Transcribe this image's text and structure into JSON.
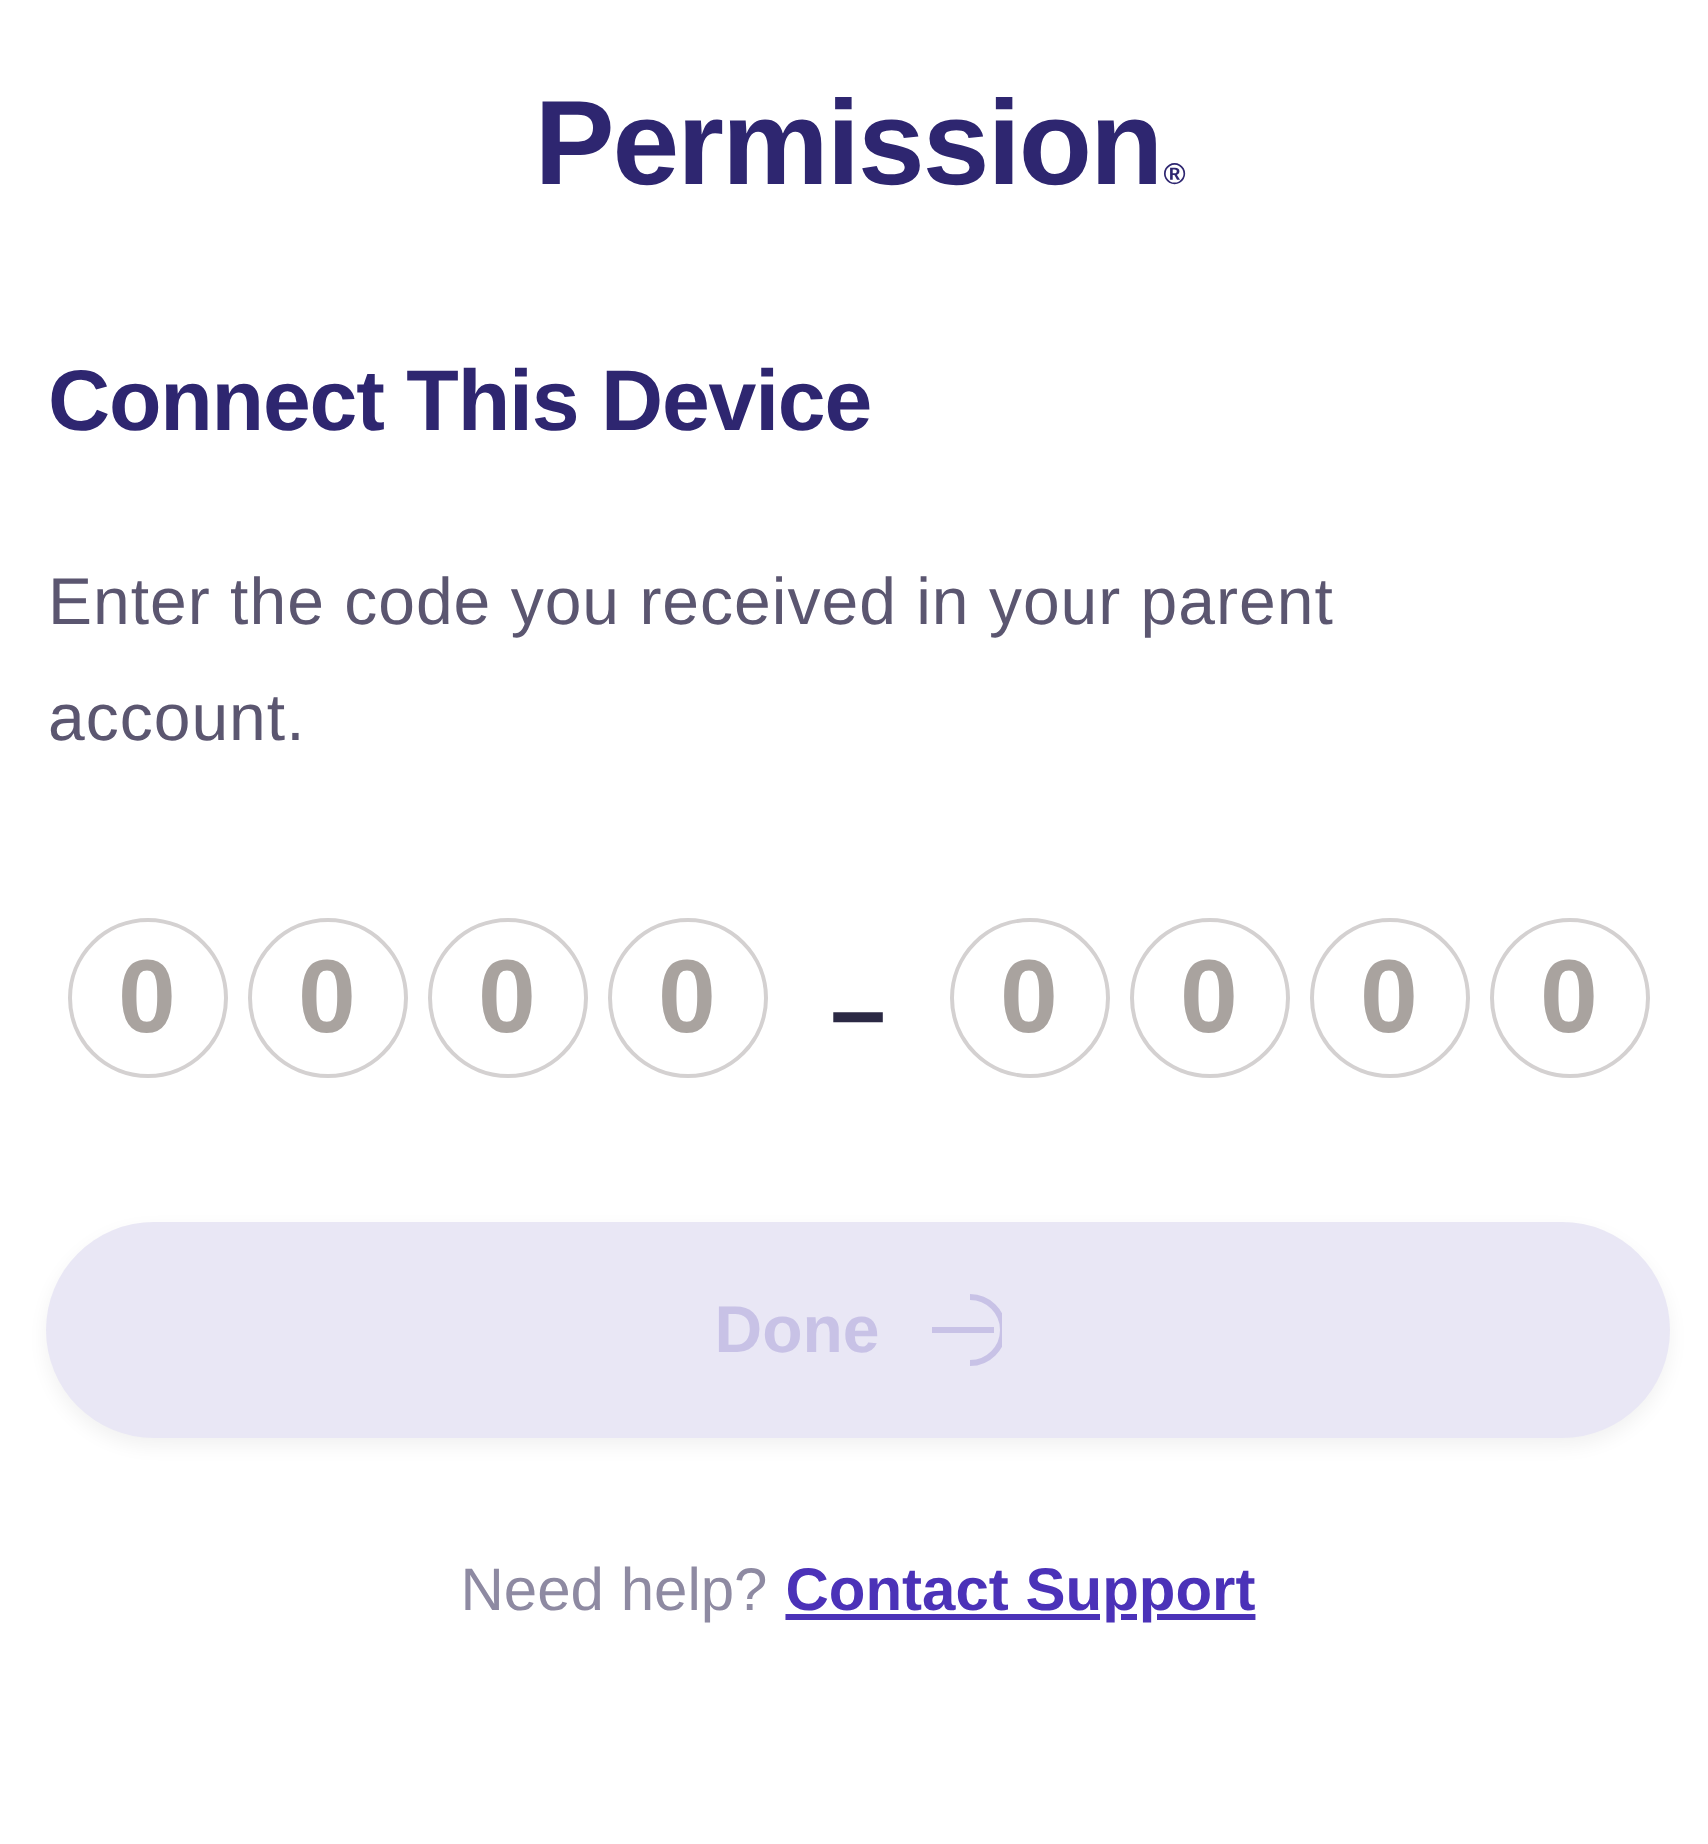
{
  "logo": {
    "text": "Permission",
    "mark": "®"
  },
  "title": "Connect This Device",
  "instructions": "Enter the code you received in your parent account.",
  "code": {
    "groups": [
      {
        "digits": [
          {
            "placeholder": "0"
          },
          {
            "placeholder": "0"
          },
          {
            "placeholder": "0"
          },
          {
            "placeholder": "0"
          }
        ]
      },
      {
        "digits": [
          {
            "placeholder": "0"
          },
          {
            "placeholder": "0"
          },
          {
            "placeholder": "0"
          },
          {
            "placeholder": "0"
          }
        ]
      }
    ],
    "separator": "–"
  },
  "done_button": {
    "label": "Done",
    "disabled": true
  },
  "help": {
    "text": "Need help?",
    "link": "Contact Support"
  }
}
